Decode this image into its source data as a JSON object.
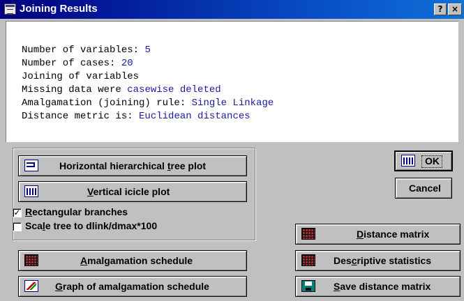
{
  "window": {
    "title": "Joining Results",
    "help_button": "?",
    "close_button": "×"
  },
  "info": [
    {
      "label": "Number of variables: ",
      "value": "5"
    },
    {
      "label": "Number of cases: ",
      "value": "20"
    },
    {
      "label": "Joining of variables",
      "value": ""
    },
    {
      "label": "Missing data were ",
      "value": "casewise deleted"
    },
    {
      "label": "Amalgamation (joining) rule: ",
      "value": "Single Linkage"
    },
    {
      "label": "Distance metric is: ",
      "value": "Euclidean distances"
    }
  ],
  "buttons": {
    "horizontal_tree": {
      "pre": "Horizontal hierarchical ",
      "key": "t",
      "post": "ree plot",
      "icon": "tree-plot-icon"
    },
    "vertical_icicle": {
      "pre": "",
      "key": "V",
      "post": "ertical icicle plot",
      "icon": "icicle-plot-icon"
    },
    "amalgamation_schedule": {
      "pre": "",
      "key": "A",
      "post": "malgamation schedule",
      "icon": "grid-icon"
    },
    "graph_amalgamation": {
      "pre": "",
      "key": "G",
      "post": "raph of amalgamation schedule",
      "icon": "graph-icon"
    },
    "ok": "OK",
    "cancel": "Cancel",
    "distance_matrix": {
      "pre": "",
      "key": "D",
      "post": "istance matrix",
      "icon": "grid-icon"
    },
    "descriptive_stats": {
      "pre": "Des",
      "key": "c",
      "post": "riptive statistics",
      "icon": "grid-icon"
    },
    "save_distance": {
      "pre": "",
      "key": "S",
      "post": "ave distance matrix",
      "icon": "save-icon"
    }
  },
  "checkboxes": {
    "rectangular": {
      "pre": "",
      "key": "R",
      "post": "ectangular branches",
      "checked": true,
      "mark": "✓"
    },
    "scale_tree": {
      "pre": "Sca",
      "key": "l",
      "post": "e tree to dlink/dmax*100",
      "checked": false,
      "mark": ""
    }
  }
}
